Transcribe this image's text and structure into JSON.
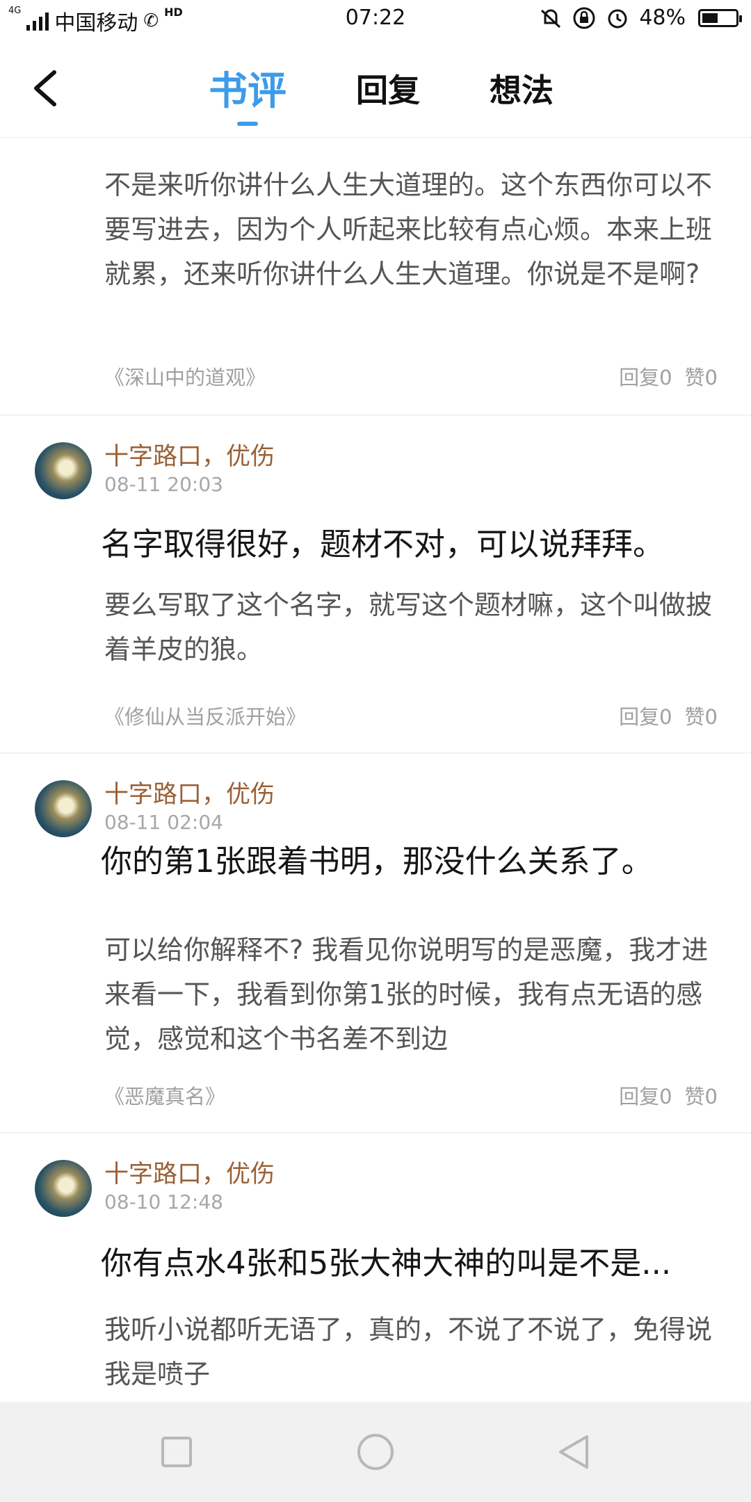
{
  "status": {
    "network": "4G",
    "carrier": "中国移动",
    "hd": "HD",
    "time": "07:22",
    "battery": "48%",
    "battery_level": 0.48
  },
  "header": {
    "tabs": [
      "书评",
      "回复",
      "想法"
    ],
    "active_tab": 0
  },
  "cards": [
    {
      "body": "不是来听你讲什么人生大道理的。这个东西你可以不要写进去，因为个人听起来比较有点心烦。本来上班就累，还来听你讲什么人生大道理。你说是不是啊?",
      "book": "《深山中的道观》",
      "replies": "回复0",
      "likes": "赞0"
    },
    {
      "author": "十字路口，优伤",
      "date": "08-11 20:03",
      "title": "名字取得很好，题材不对，可以说拜拜。",
      "body": "要么写取了这个名字，就写这个题材嘛，这个叫做披着羊皮的狼。",
      "book": "《修仙从当反派开始》",
      "replies": "回复0",
      "likes": "赞0"
    },
    {
      "author": "十字路口，优伤",
      "date": "08-11 02:04",
      "title": "你的第1张跟着书明，那没什么关系了。",
      "body": "可以给你解释不? 我看见你说明写的是恶魔，我才进来看一下，我看到你第1张的时候，我有点无语的感觉，感觉和这个书名差不到边",
      "book": "《恶魔真名》",
      "replies": "回复0",
      "likes": "赞0"
    },
    {
      "author": "十字路口，优伤",
      "date": "08-10 12:48",
      "title": "你有点水4张和5张大神大神的叫是不是...",
      "body": "我听小说都听无语了，真的，不说了不说了，免得说我是喷子"
    }
  ],
  "colors": {
    "accent": "#3d9be9",
    "author": "#9a6036",
    "navbar": "#f1f1f1"
  }
}
